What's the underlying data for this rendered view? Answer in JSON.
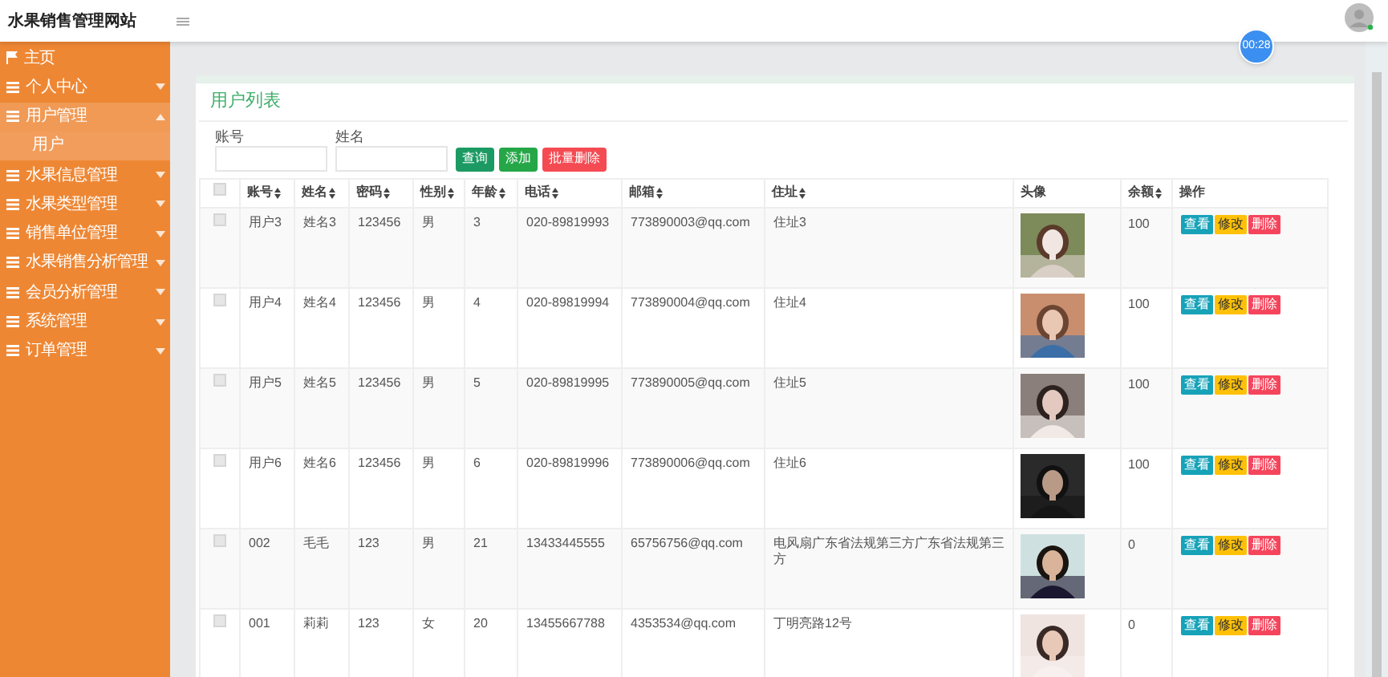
{
  "header": {
    "title": "水果销售管理网站",
    "timer": "00:28"
  },
  "sidebar": {
    "items": [
      {
        "label": "主页",
        "kind": "home",
        "expanded": false
      },
      {
        "label": "个人中心",
        "kind": "menu",
        "expanded": false
      },
      {
        "label": "用户管理",
        "kind": "menu",
        "expanded": true,
        "children": [
          {
            "label": "用户",
            "selected": true
          }
        ]
      },
      {
        "label": "水果信息管理",
        "kind": "menu",
        "expanded": false
      },
      {
        "label": "水果类型管理",
        "kind": "menu",
        "expanded": false
      },
      {
        "label": "销售单位管理",
        "kind": "menu",
        "expanded": false
      },
      {
        "label": "水果销售分析管理",
        "kind": "menu",
        "expanded": false
      },
      {
        "label": "会员分析管理",
        "kind": "menu",
        "expanded": false
      },
      {
        "label": "系统管理",
        "kind": "menu",
        "expanded": false
      },
      {
        "label": "订单管理",
        "kind": "menu",
        "expanded": false
      }
    ]
  },
  "card": {
    "title": "用户列表",
    "filters": [
      {
        "label": "账号"
      },
      {
        "label": "姓名"
      }
    ],
    "buttons": [
      {
        "label": "查询",
        "kind": "search"
      },
      {
        "label": "添加",
        "kind": "add"
      },
      {
        "label": "批量删除",
        "kind": "delete"
      }
    ],
    "table": {
      "select_all": {
        "checked": false
      },
      "columns": [
        {
          "label": "账号",
          "sortable": true
        },
        {
          "label": "姓名",
          "sortable": true
        },
        {
          "label": "密码",
          "sortable": true
        },
        {
          "label": "性别",
          "sortable": true
        },
        {
          "label": "年龄",
          "sortable": true
        },
        {
          "label": "电话",
          "sortable": true
        },
        {
          "label": "邮箱",
          "sortable": true
        },
        {
          "label": "住址",
          "sortable": true
        },
        {
          "label": "头像",
          "sortable": false
        },
        {
          "label": "余额",
          "sortable": true
        },
        {
          "label": "操作",
          "sortable": false
        }
      ],
      "rows": [
        {
          "checked": false,
          "cells": [
            "用户3",
            "姓名3",
            "123456",
            "男",
            "3",
            "020-89819993",
            "773890003@qq.com",
            "住址3"
          ],
          "balance": "100",
          "actions": [
            {
              "label": "查看",
              "kind": "view"
            },
            {
              "label": "修改",
              "kind": "edit"
            },
            {
              "label": "删除",
              "kind": "delete"
            }
          ]
        },
        {
          "checked": false,
          "cells": [
            "用户4",
            "姓名4",
            "123456",
            "男",
            "4",
            "020-89819994",
            "773890004@qq.com",
            "住址4"
          ],
          "balance": "100",
          "actions": [
            {
              "label": "查看",
              "kind": "view"
            },
            {
              "label": "修改",
              "kind": "edit"
            },
            {
              "label": "删除",
              "kind": "delete"
            }
          ]
        },
        {
          "checked": false,
          "cells": [
            "用户5",
            "姓名5",
            "123456",
            "男",
            "5",
            "020-89819995",
            "773890005@qq.com",
            "住址5"
          ],
          "balance": "100",
          "actions": [
            {
              "label": "查看",
              "kind": "view"
            },
            {
              "label": "修改",
              "kind": "edit"
            },
            {
              "label": "删除",
              "kind": "delete"
            }
          ]
        },
        {
          "checked": false,
          "cells": [
            "用户6",
            "姓名6",
            "123456",
            "男",
            "6",
            "020-89819996",
            "773890006@qq.com",
            "住址6"
          ],
          "balance": "100",
          "actions": [
            {
              "label": "查看",
              "kind": "view"
            },
            {
              "label": "修改",
              "kind": "edit"
            },
            {
              "label": "删除",
              "kind": "delete"
            }
          ]
        },
        {
          "checked": false,
          "cells": [
            "002",
            "毛毛",
            "123",
            "男",
            "21",
            "13433445555",
            "65756756@qq.com",
            "电风扇广东省法规第三方广东省法规第三方"
          ],
          "balance": "0",
          "actions": [
            {
              "label": "查看",
              "kind": "view"
            },
            {
              "label": "修改",
              "kind": "edit"
            },
            {
              "label": "删除",
              "kind": "delete"
            }
          ]
        },
        {
          "checked": false,
          "cells": [
            "001",
            "莉莉",
            "123",
            "女",
            "20",
            "13455667788",
            "4353534@qq.com",
            "丁明亮路12号"
          ],
          "balance": "0",
          "actions": [
            {
              "label": "查看",
              "kind": "view"
            },
            {
              "label": "修改",
              "kind": "edit"
            },
            {
              "label": "删除",
              "kind": "delete"
            }
          ]
        }
      ]
    }
  }
}
